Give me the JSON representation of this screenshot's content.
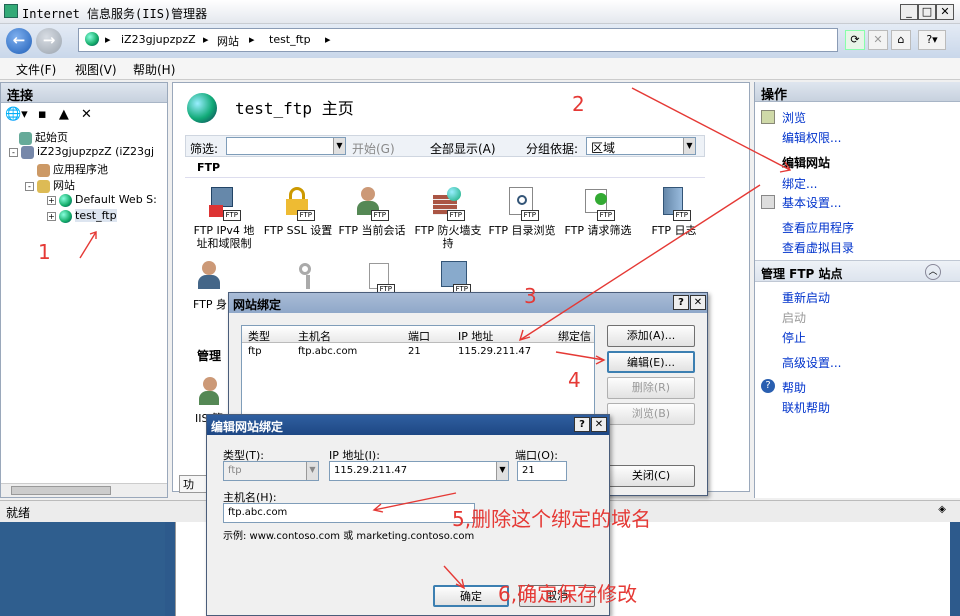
{
  "window": {
    "title": "Internet 信息服务(IIS)管理器",
    "min": "_",
    "max": "□",
    "close": "✕"
  },
  "address": {
    "segments": [
      "iZ23gjupzpzZ",
      "网站",
      "test_ftp"
    ]
  },
  "menu": [
    "文件(F)",
    "视图(V)",
    "帮助(H)"
  ],
  "connections": {
    "title": "连接",
    "tree": [
      {
        "label": "起始页"
      },
      {
        "label": "iZ23gjupzpzZ (iZ23gj"
      },
      {
        "label": "应用程序池"
      },
      {
        "label": "网站"
      },
      {
        "label": "Default Web S:"
      },
      {
        "label": "test_ftp"
      }
    ]
  },
  "center": {
    "title": "test_ftp 主页",
    "filter_label": "筛选:",
    "start_label": "开始(G)",
    "showall_label": "全部显示(A)",
    "groupby_label": "分组依据:",
    "groupby_value": "区域",
    "section_ftp": "FTP",
    "section_manage": "管理",
    "features": [
      {
        "label": "FTP IPv4 地址和域限制"
      },
      {
        "label": "FTP SSL 设置"
      },
      {
        "label": "FTP 当前会话"
      },
      {
        "label": "FTP 防火墙支持"
      },
      {
        "label": "FTP 目录浏览"
      },
      {
        "label": "FTP 请求筛选"
      },
      {
        "label": "FTP 日志"
      }
    ],
    "row2_label": "FTP 身",
    "row3_label": "IIS 管",
    "tab_label": "功"
  },
  "actions": {
    "title": "操作",
    "items": [
      "浏览",
      "编辑权限...",
      "编辑网站",
      "绑定...",
      "基本设置...",
      "查看应用程序",
      "查看虚拟目录",
      "管理 FTP 站点",
      "重新启动",
      "启动",
      "停止",
      "高级设置...",
      "帮助",
      "联机帮助"
    ]
  },
  "status": {
    "text": "就绪"
  },
  "binding_dialog": {
    "title": "网站绑定",
    "help": "?",
    "close": "✕",
    "columns": [
      "类型",
      "主机名",
      "端口",
      "IP 地址",
      "绑定信"
    ],
    "row": {
      "type": "ftp",
      "host": "ftp.abc.com",
      "port": "21",
      "ip": "115.29.211.47"
    },
    "add": "添加(A)...",
    "edit": "编辑(E)...",
    "remove": "删除(R)",
    "browse": "浏览(B)",
    "closebtn": "关闭(C)"
  },
  "edit_dialog": {
    "title": "编辑网站绑定",
    "help": "?",
    "close": "✕",
    "type_label": "类型(T):",
    "type_value": "ftp",
    "ip_label": "IP 地址(I):",
    "ip_value": "115.29.211.47",
    "port_label": "端口(O):",
    "port_value": "21",
    "host_label": "主机名(H):",
    "host_value": "ftp.abc.com",
    "example": "示例: www.contoso.com 或 marketing.contoso.com",
    "ok": "确定",
    "cancel": "取消"
  },
  "annotations": {
    "a1": "1",
    "a2": "2",
    "a3": "3",
    "a4": "4",
    "a5": "5,删除这个绑定的域名",
    "a6": "6,确定保存修改"
  }
}
